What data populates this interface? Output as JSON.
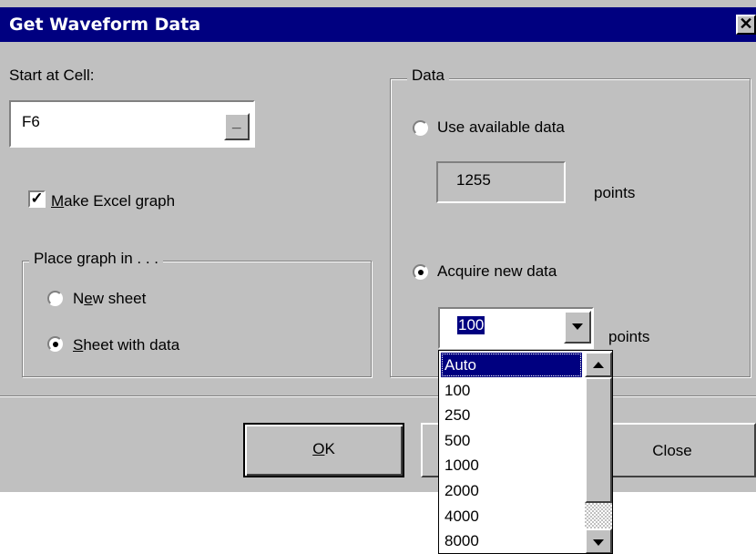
{
  "window": {
    "title": "Get Waveform Data",
    "close_glyph": "✕"
  },
  "start_cell": {
    "label": "Start at Cell:",
    "value": "F6",
    "picker_glyph": "_"
  },
  "make_graph": {
    "label_accel": "M",
    "label_rest": "ake Excel graph",
    "checked": true,
    "check_glyph": "✓"
  },
  "place_graph": {
    "legend": "Place graph in . . .",
    "new_sheet": {
      "pre": "N",
      "accel": "e",
      "post": "w sheet",
      "selected": false
    },
    "sheet_with_data": {
      "pre": "",
      "accel": "S",
      "post": "heet with data",
      "selected": true
    }
  },
  "data_group": {
    "legend": "Data",
    "use_available": {
      "label": "Use available data",
      "selected": false
    },
    "available_points": {
      "value": "1255",
      "unit": "points"
    },
    "acquire_new": {
      "label": "Acquire new data",
      "selected": true
    },
    "new_points": {
      "value": "100",
      "unit": "points",
      "options": [
        "Auto",
        "100",
        "250",
        "500",
        "1000",
        "2000",
        "4000",
        "8000"
      ],
      "highlighted_option": "Auto"
    }
  },
  "buttons": {
    "ok_accel": "O",
    "ok_rest": "K",
    "close": "Close"
  },
  "colors": {
    "face": "#c0c0c0",
    "title_bar": "#000080",
    "highlight": "#000080"
  }
}
